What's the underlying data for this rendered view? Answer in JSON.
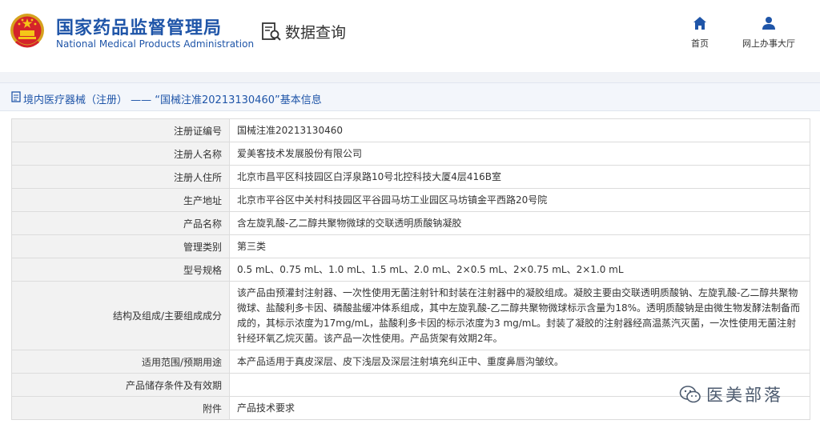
{
  "header": {
    "org_name_cn": "国家药品监督管理局",
    "org_name_en": "National Medical Products Administration",
    "data_query_label": "数据查询",
    "nav": {
      "home_label": "首页",
      "service_label": "网上办事大厅"
    }
  },
  "title": {
    "text": "境内医疗器械（注册） —— “国械注准20213130460”基本信息"
  },
  "rows": [
    {
      "label": "注册证编号",
      "value": "国械注准20213130460"
    },
    {
      "label": "注册人名称",
      "value": "爱美客技术发展股份有限公司"
    },
    {
      "label": "注册人住所",
      "value": "北京市昌平区科技园区白浮泉路10号北控科技大厦4层416B室"
    },
    {
      "label": "生产地址",
      "value": "北京市平谷区中关村科技园区平谷园马坊工业园区马坊镇金平西路20号院"
    },
    {
      "label": "产品名称",
      "value": "含左旋乳酸-乙二醇共聚物微球的交联透明质酸钠凝胶"
    },
    {
      "label": "管理类别",
      "value": "第三类"
    },
    {
      "label": "型号规格",
      "value": "0.5 mL、0.75 mL、1.0 mL、1.5 mL、2.0 mL、2×0.5 mL、2×0.75 mL、2×1.0 mL"
    },
    {
      "label": "结构及组成/主要组成成分",
      "value": "该产品由预灌封注射器、一次性使用无菌注射针和封装在注射器中的凝胶组成。凝胶主要由交联透明质酸钠、左旋乳酸-乙二醇共聚物微球、盐酸利多卡因、磷酸盐缓冲体系组成，其中左旋乳酸-乙二醇共聚物微球标示含量为18%。透明质酸钠是由微生物发酵法制备而成的，其标示浓度为17mg/mL，盐酸利多卡因的标示浓度为3 mg/mL。封装了凝胶的注射器经高温蒸汽灭菌，一次性使用无菌注射针经环氧乙烷灭菌。该产品一次性使用。产品货架有效期2年。"
    },
    {
      "label": "适用范围/预期用途",
      "value": "本产品适用于真皮深层、皮下浅层及深层注射填充纠正中、重度鼻唇沟皱纹。"
    },
    {
      "label": "产品储存条件及有效期",
      "value": ""
    },
    {
      "label": "附件",
      "value": "产品技术要求"
    }
  ],
  "watermark": {
    "text": "医美部落"
  },
  "colors": {
    "brand_blue": "#1f55a8",
    "label_bg": "#f2f2f2",
    "border": "#dcdcdc"
  }
}
